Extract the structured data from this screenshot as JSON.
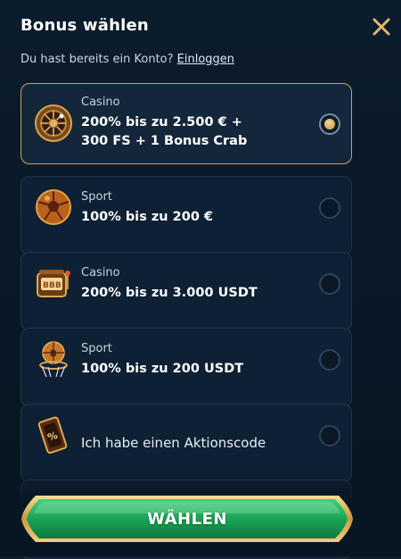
{
  "header": {
    "title": "Bonus wählen",
    "close_icon": "close-icon"
  },
  "login": {
    "prefix": "Du hast bereits ein Konto?",
    "link": "Einloggen"
  },
  "options": [
    {
      "category": "Casino",
      "line1": "200% bis zu 2.500 € +",
      "line2": "300 FS + 1 Bonus Crab",
      "icon": "roulette-icon",
      "selected": true
    },
    {
      "category": "Sport",
      "line1": "100% bis zu 200 €",
      "icon": "soccer-ball-icon",
      "selected": false
    },
    {
      "category": "Casino",
      "line1": "200% bis zu 3.000 USDT",
      "icon": "slot-machine-icon",
      "selected": false
    },
    {
      "category": "Sport",
      "line1": "100% bis zu 200 USDT",
      "icon": "basketball-icon",
      "selected": false
    },
    {
      "label": "Ich habe einen Aktionscode",
      "icon": "promo-ticket-icon",
      "selected": false
    }
  ],
  "cta": {
    "label": "WÄHLEN"
  },
  "colors": {
    "gold": "#c9a35a",
    "green": "#1fa85a",
    "background": "#0b1c2d"
  }
}
